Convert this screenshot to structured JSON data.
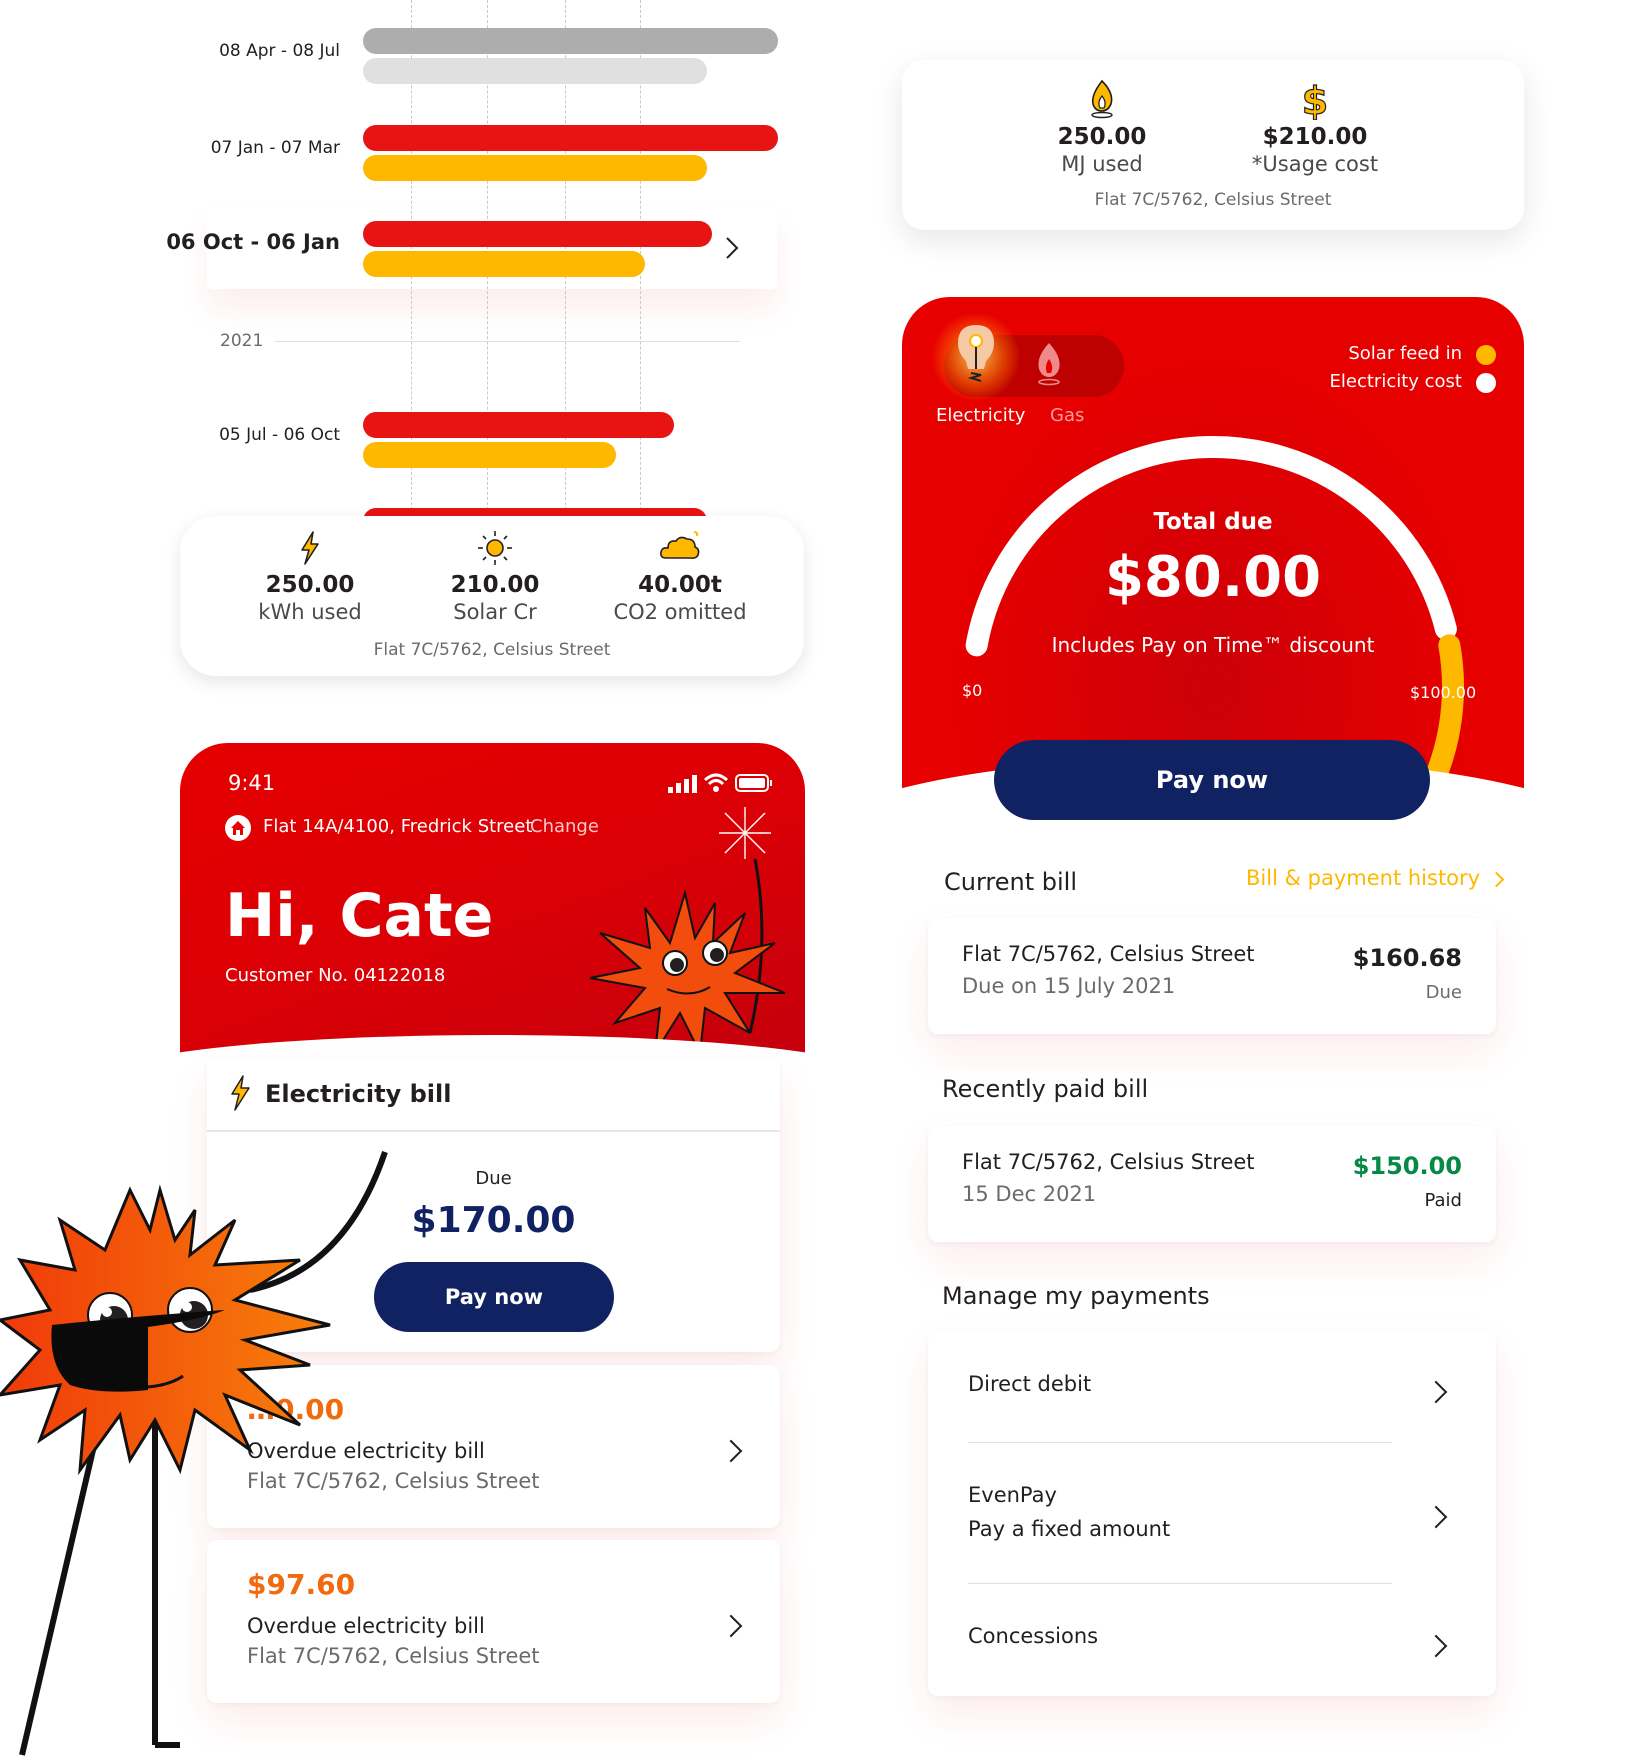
{
  "usage_chart": {
    "periods": [
      {
        "label": "08 Apr - 08 Jul",
        "active": false,
        "primary_value": 1.0,
        "secondary_value": 0.83,
        "style": "past"
      },
      {
        "label": "07 Jan - 07 Mar",
        "active": false,
        "primary_value": 1.0,
        "secondary_value": 0.83,
        "style": "current"
      },
      {
        "label": "06 Oct - 06 Jan",
        "active": true,
        "primary_value": 0.84,
        "secondary_value": 0.68,
        "style": "current"
      },
      {
        "label": "05 Jul - 06 Oct",
        "active": false,
        "primary_value": 0.75,
        "secondary_value": 0.61,
        "style": "current"
      }
    ],
    "partial_next_bar_value": 0.83,
    "year_divider": "2021",
    "colors": {
      "past_primary": "#adadad",
      "past_secondary": "#e0e0e0",
      "primary": "#e81313",
      "secondary": "#ffb800"
    }
  },
  "electricity_stats": {
    "items": [
      {
        "icon": "lightning-icon",
        "value": "250.00",
        "label": "kWh used"
      },
      {
        "icon": "sun-icon",
        "value": "210.00",
        "label": "Solar Cr"
      },
      {
        "icon": "cloud-icon",
        "value": "40.00t",
        "label": "CO2 omitted"
      }
    ],
    "address": "Flat 7C/5762, Celsius Street"
  },
  "gas_stats": {
    "items": [
      {
        "icon": "gas-flame-icon",
        "value": "250.00",
        "label": "MJ used"
      },
      {
        "icon": "dollar-icon",
        "value": "$210.00",
        "label": "*Usage cost"
      }
    ],
    "address": "Flat 7C/5762, Celsius Street"
  },
  "gauge": {
    "toggle": {
      "options": [
        "Electricity",
        "Gas"
      ],
      "selected": "Electricity"
    },
    "legend": [
      {
        "label": "Solar feed in",
        "color": "#ffb800"
      },
      {
        "label": "Electricity cost",
        "color": "#ffffff"
      }
    ],
    "title": "Total due",
    "amount": "$80.00",
    "note": "Includes Pay on Time™ discount",
    "min_label": "$0",
    "max_label": "$100.00",
    "min_value": 0,
    "max_value": 100,
    "electricity_cost_fraction": 0.78,
    "solar_fraction_start": 0.8,
    "pay_button": "Pay now"
  },
  "current_bill": {
    "title": "Current bill",
    "history_link": "Bill & payment history",
    "address": "Flat 7C/5762, Celsius Street",
    "due_text": "Due on 15 July 2021",
    "amount": "$160.68",
    "status": "Due"
  },
  "recent_bill": {
    "title": "Recently paid bill",
    "address": "Flat 7C/5762, Celsius Street",
    "date": "15 Dec 2021",
    "amount": "$150.00",
    "status": "Paid",
    "amount_color": "#058a45"
  },
  "manage_payments": {
    "title": "Manage my payments",
    "items": [
      {
        "label": "Direct debit",
        "sub": ""
      },
      {
        "label": "EvenPay",
        "sub": "Pay a fixed amount"
      },
      {
        "label": "Concessions",
        "sub": ""
      }
    ]
  },
  "home_header": {
    "time": "9:41",
    "address": "Flat 14A/4100, Fredrick Street",
    "change_label": "Change",
    "greeting": "Hi, Cate",
    "customer_no": "Customer No. 04122018"
  },
  "electricity_bill": {
    "title": "Electricity bill",
    "due_label": "Due",
    "due_amount": "$170.00",
    "pay_button": "Pay now",
    "overdue": [
      {
        "amount": "…0.00",
        "label": "Overdue electricity bill",
        "address": "Flat 7C/5762, Celsius Street"
      },
      {
        "amount": "$97.60",
        "label": "Overdue electricity bill",
        "address": "Flat 7C/5762, Celsius Street"
      }
    ],
    "overdue_color": "#f26a0f"
  },
  "colors": {
    "brand_red": "#e60000",
    "navy": "#112263",
    "amber": "#ffb800"
  }
}
